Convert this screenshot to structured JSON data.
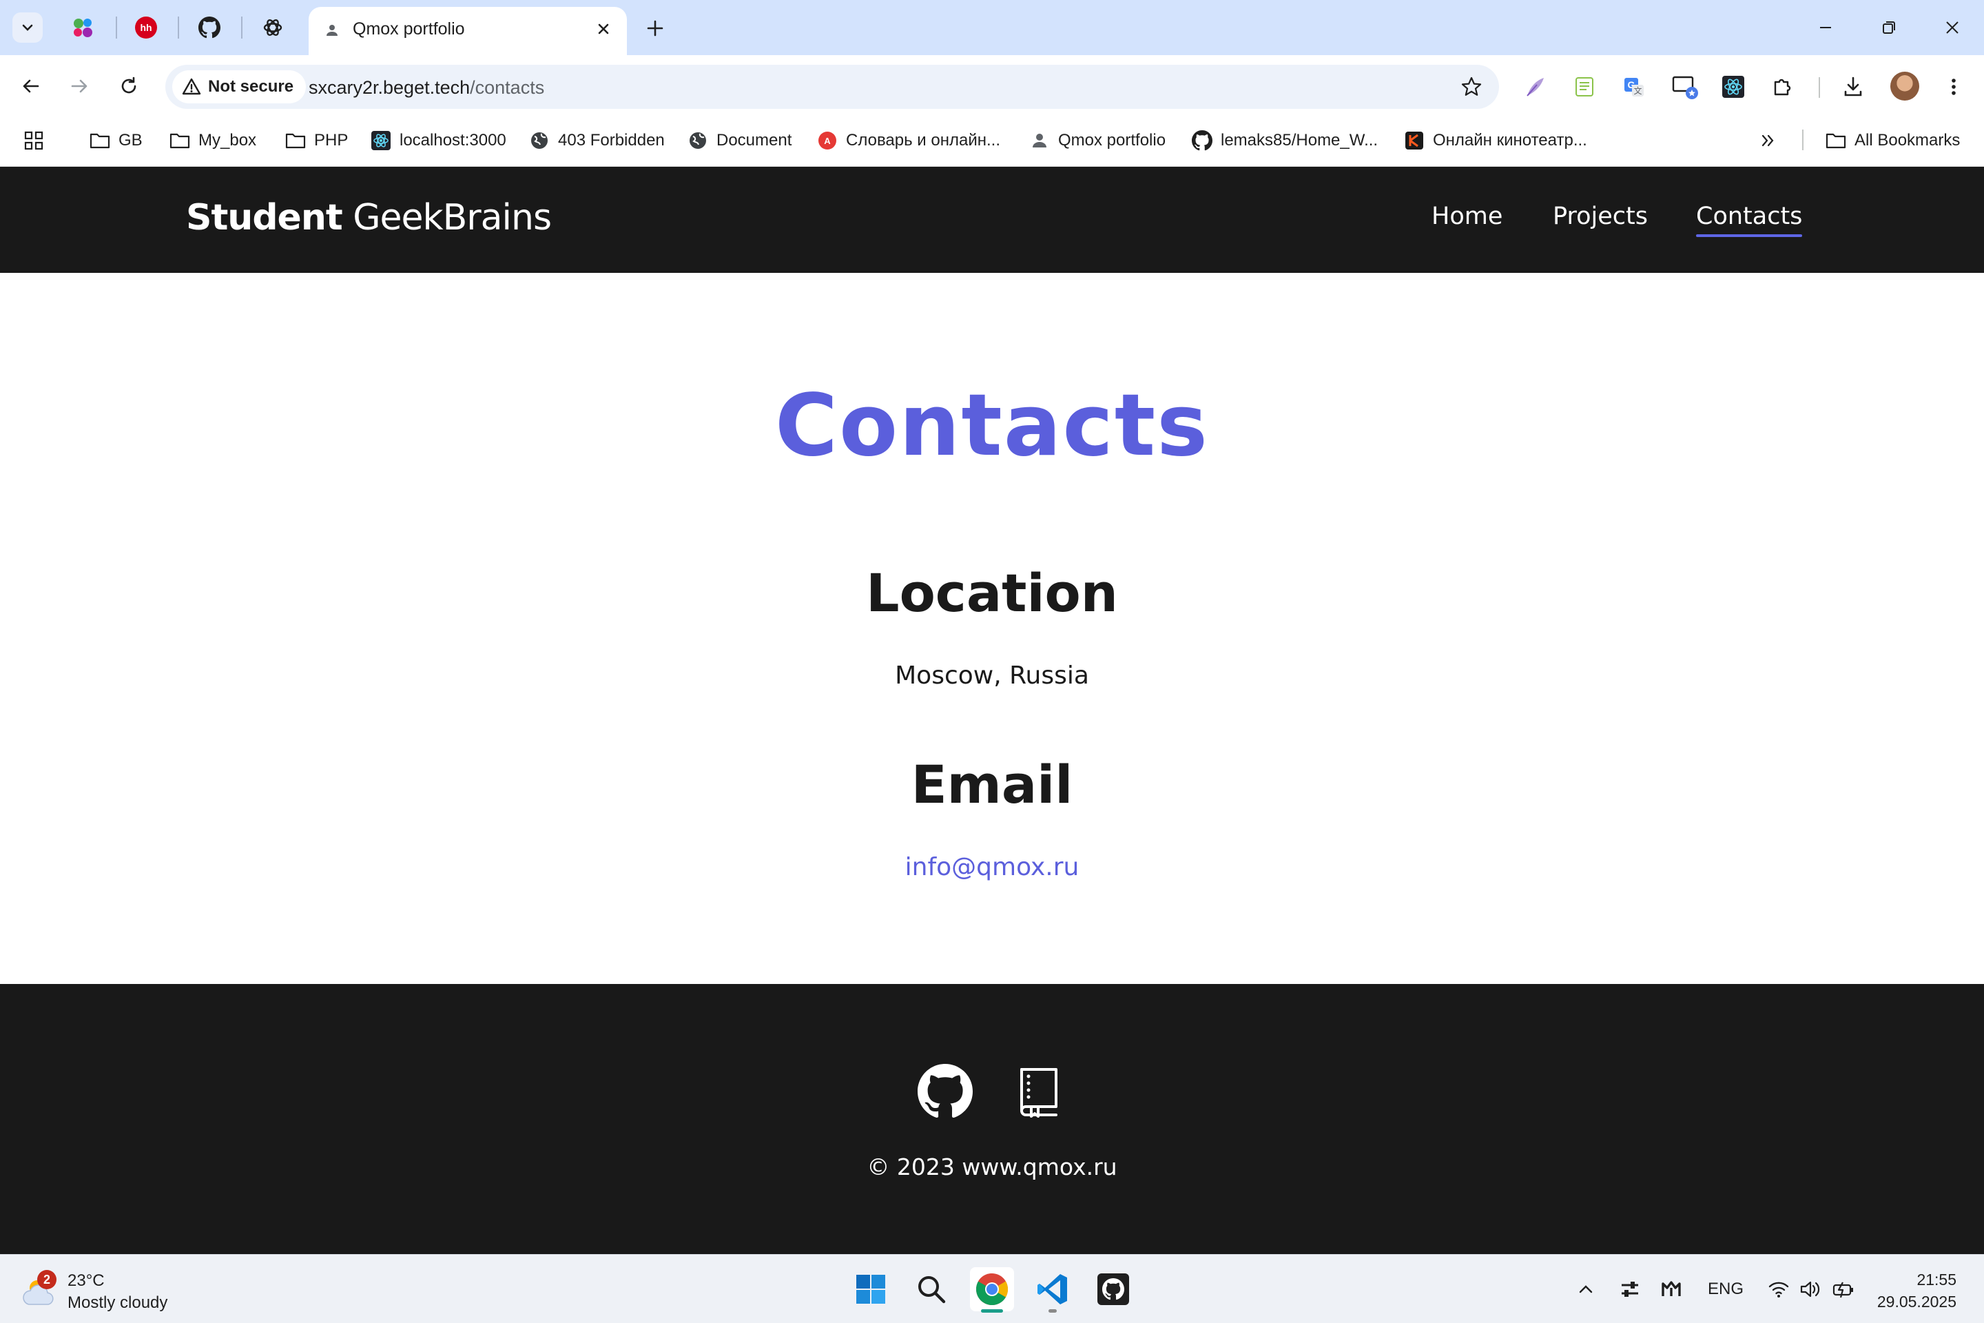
{
  "browser": {
    "active_tab_title": "Qmox portfolio",
    "security_label": "Not secure",
    "url_host": "sxcary2r.beget.tech",
    "url_path": "/contacts",
    "pinned_tabs": [
      "cluster-icon",
      "hh-icon",
      "github-icon",
      "openai-icon"
    ],
    "bookmarks": [
      {
        "label": "GB",
        "icon": "folder-icon"
      },
      {
        "label": "My_box",
        "icon": "folder-icon"
      },
      {
        "label": "PHP",
        "icon": "folder-icon"
      },
      {
        "label": "localhost:3000",
        "icon": "react-icon"
      },
      {
        "label": "403 Forbidden",
        "icon": "globe-icon"
      },
      {
        "label": "Document",
        "icon": "globe-icon"
      },
      {
        "label": "Словарь и онлайн...",
        "icon": "dictionary-icon"
      },
      {
        "label": "Qmox portfolio",
        "icon": "person-icon"
      },
      {
        "label": "lemaks85/Home_W...",
        "icon": "github-icon"
      },
      {
        "label": "Онлайн кинотеатр...",
        "icon": "cinema-icon"
      }
    ],
    "all_bookmarks_label": "All Bookmarks"
  },
  "site": {
    "brand_bold": "Student",
    "brand_rest": " GeekBrains",
    "nav": [
      {
        "label": "Home",
        "active": false
      },
      {
        "label": "Projects",
        "active": false
      },
      {
        "label": "Contacts",
        "active": true
      }
    ],
    "page_title": "Contacts",
    "location_heading": "Location",
    "location_text": "Moscow, Russia",
    "email_heading": "Email",
    "email_text": "info@qmox.ru",
    "footer_icons": [
      "github-icon",
      "book-icon"
    ],
    "copyright": "© 2023 www.qmox.ru"
  },
  "colors": {
    "accent": "#5b5fdc",
    "header_bg": "#191919",
    "chrome_tabbar": "#d3e3fd"
  },
  "taskbar": {
    "weather_temp": "23°C",
    "weather_desc": "Mostly cloudy",
    "weather_badge": "2",
    "language": "ENG",
    "time": "21:55",
    "date": "29.05.2025",
    "apps": [
      "windows-start-icon",
      "search-icon",
      "chrome-icon",
      "vscode-icon",
      "github-desktop-icon"
    ]
  }
}
